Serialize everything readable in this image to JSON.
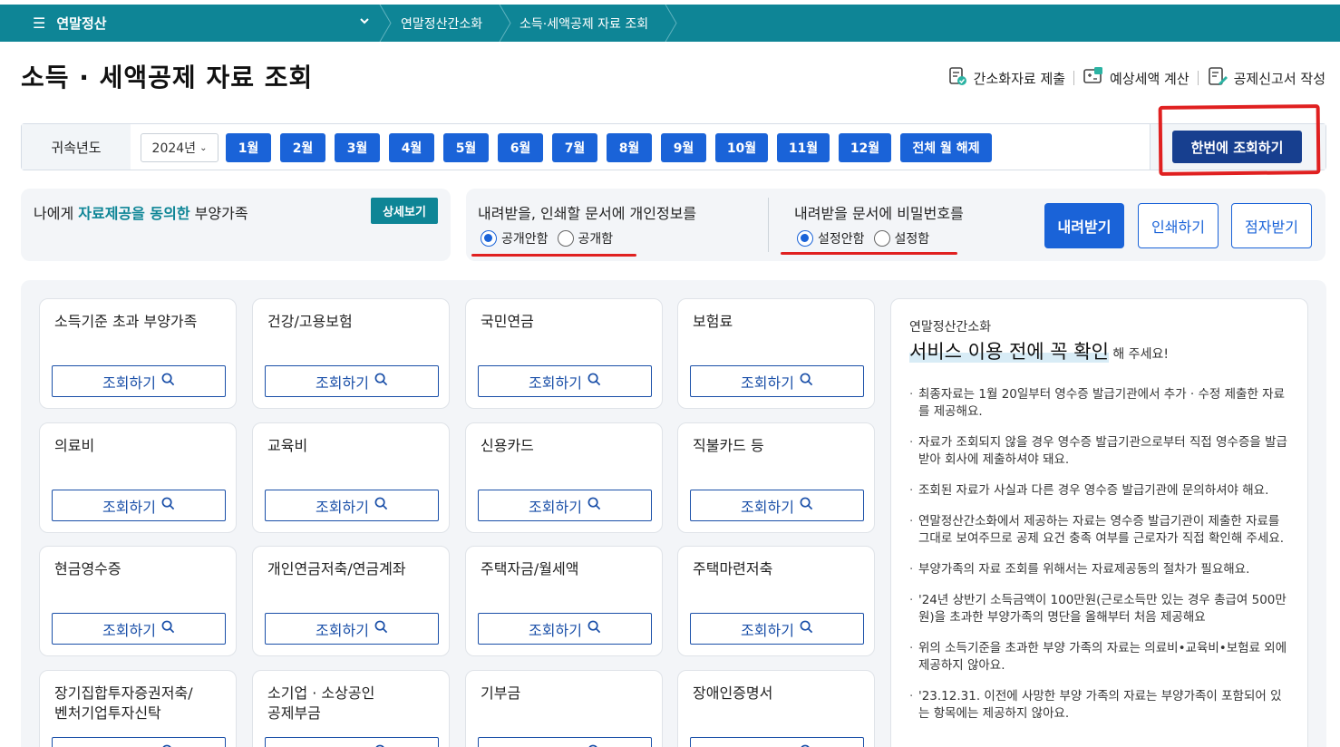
{
  "nav": {
    "menu_label": "연말정산",
    "crumbs": [
      "연말정산간소화",
      "소득·세액공제 자료 조회"
    ]
  },
  "header": {
    "title": "소득 · 세액공제 자료 조회",
    "actions": [
      {
        "label": "간소화자료 제출",
        "icon": "document-submit-icon"
      },
      {
        "label": "예상세액 계산",
        "icon": "calculator-icon"
      },
      {
        "label": "공제신고서 작성",
        "icon": "form-edit-icon"
      }
    ]
  },
  "filter": {
    "label": "귀속년도",
    "year": "2024년",
    "months": [
      "1월",
      "2월",
      "3월",
      "4월",
      "5월",
      "6월",
      "7월",
      "8월",
      "9월",
      "10월",
      "11월",
      "12월"
    ],
    "clear_label": "전체 월 해제",
    "query_all_label": "한번에 조회하기"
  },
  "family": {
    "text_pre": "나에게 ",
    "text_hl": "자료제공을 동의한",
    "text_post": " 부양가족",
    "detail_label": "상세보기"
  },
  "docs": {
    "personal_info": {
      "title": "내려받을, 인쇄할 문서에 개인정보를",
      "options": [
        "공개안함",
        "공개함"
      ],
      "selected": 0
    },
    "password": {
      "title": "내려받을 문서에 비밀번호를",
      "options": [
        "설정안함",
        "설정함"
      ],
      "selected": 0
    },
    "download_label": "내려받기",
    "print_label": "인쇄하기",
    "braille_label": "점자받기"
  },
  "cards": [
    {
      "title": "소득기준 초과 부양가족"
    },
    {
      "title": "건강/고용보험"
    },
    {
      "title": "국민연금"
    },
    {
      "title": "보험료"
    },
    {
      "title": "의료비"
    },
    {
      "title": "교육비"
    },
    {
      "title": "신용카드"
    },
    {
      "title": "직불카드 등"
    },
    {
      "title": "현금영수증"
    },
    {
      "title": "개인연금저축/연금계좌"
    },
    {
      "title": "주택자금/월세액"
    },
    {
      "title": "주택마련저축"
    },
    {
      "title": "장기집합투자증권저축/\n벤처기업투자신탁"
    },
    {
      "title": "소기업 · 소상공인\n공제부금"
    },
    {
      "title": "기부금"
    },
    {
      "title": "장애인증명서"
    }
  ],
  "query_label": "조회하기",
  "notice": {
    "small": "연말정산간소화",
    "big": "서비스 이용 전에 꼭 확인",
    "big_suffix": " 해 주세요!",
    "items": [
      "최종자료는 1월 20일부터 영수증 발급기관에서 추가 · 수정 제출한 자료를 제공해요.",
      "자료가 조회되지 않을 경우 영수증 발급기관으로부터 직접 영수증을 발급받아 회사에 제출하셔야 돼요.",
      "조회된 자료가 사실과 다른 경우 영수증 발급기관에 문의하셔야 해요.",
      "연말정산간소화에서 제공하는 자료는 영수증 발급기관이 제출한 자료를 그대로 보여주므로 공제 요건 충족 여부를 근로자가 직접 확인해 주세요.",
      "부양가족의 자료 조회를 위해서는 자료제공동의 절차가 필요해요.",
      "'24년 상반기 소득금액이 100만원(근로소득만 있는 경우 총급여 500만원)을 초과한 부양가족의 명단을 올해부터 처음 제공해요",
      "위의 소득기준을 초과한 부양 가족의 자료는 의료비•교육비•보험료 외에 제공하지 않아요.",
      "'23.12.31. 이전에 사망한 부양 가족의 자료는 부양가족이 포함되어 있는 항목에는 제공하지 않아요."
    ]
  },
  "colors": {
    "teal": "#0e8596",
    "primary": "#1a63d8",
    "navy": "#173f8f",
    "annotation_red": "#e02020"
  }
}
